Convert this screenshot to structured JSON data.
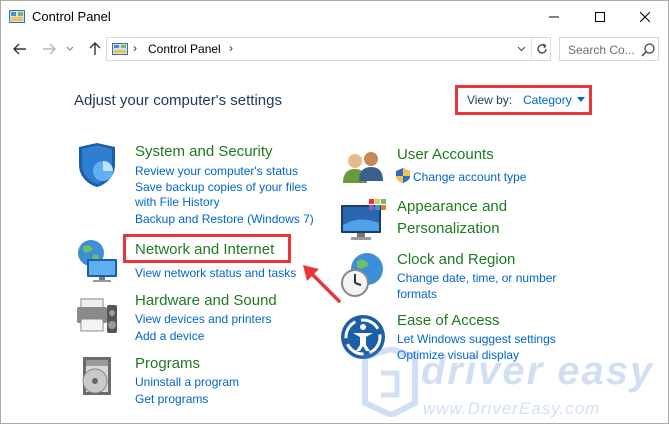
{
  "window": {
    "title": "Control Panel",
    "icon": "control-panel-icon"
  },
  "nav": {
    "back_icon": "back-arrow-icon",
    "forward_icon": "forward-arrow-icon",
    "up_icon": "up-arrow-icon",
    "address_path": "Control Panel",
    "search_placeholder": "Search Co..."
  },
  "content": {
    "heading": "Adjust your computer's settings",
    "view_by_label": "View by:",
    "view_by_value": "Category",
    "categories": [
      {
        "title": "System and Security",
        "icon": "shield-chart-icon",
        "links": [
          "Review your computer's status",
          "Save backup copies of your files",
          "with File History",
          "Backup and Restore (Windows 7)"
        ]
      },
      {
        "title": "Network and Internet",
        "icon": "globe-network-icon",
        "links": [
          "View network status and tasks"
        ]
      },
      {
        "title": "Hardware and Sound",
        "icon": "printer-speaker-icon",
        "links": [
          "View devices and printers",
          "Add a device"
        ]
      },
      {
        "title": "Programs",
        "icon": "programs-disc-icon",
        "links": [
          "Uninstall a program",
          "Get programs"
        ]
      },
      {
        "title": "User Accounts",
        "icon": "users-icon",
        "links": [
          "Change account type"
        ]
      },
      {
        "title": "Appearance and",
        "title2": "Personalization",
        "icon": "monitor-palette-icon",
        "links": []
      },
      {
        "title": "Clock and Region",
        "icon": "clock-globe-icon",
        "links": [
          "Change date, time, or number",
          "formats"
        ]
      },
      {
        "title": "Ease of Access",
        "icon": "ease-of-access-icon",
        "links": [
          "Let Windows suggest settings",
          "Optimize visual display"
        ]
      }
    ]
  },
  "watermark": {
    "brand": "driver easy",
    "url": "www.DriverEasy.com"
  },
  "colors": {
    "highlight_red": "#e8363c",
    "link_blue": "#0066cc",
    "category_green": "#1f7a1f"
  }
}
